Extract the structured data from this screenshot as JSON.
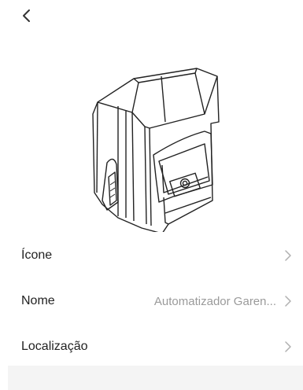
{
  "header": {
    "back_icon": "chevron-left-icon"
  },
  "device": {
    "image_icon": "gate-motor-image"
  },
  "settings": {
    "rows": [
      {
        "label": "Ícone",
        "value": ""
      },
      {
        "label": "Nome",
        "value": "Automatizador Garen..."
      },
      {
        "label": "Localização",
        "value": ""
      }
    ]
  },
  "colors": {
    "background": "#ffffff",
    "text": "#222222",
    "secondary_text": "#9a9a9a",
    "chevron": "#b0b0b0",
    "panel": "#f4f4f4"
  }
}
